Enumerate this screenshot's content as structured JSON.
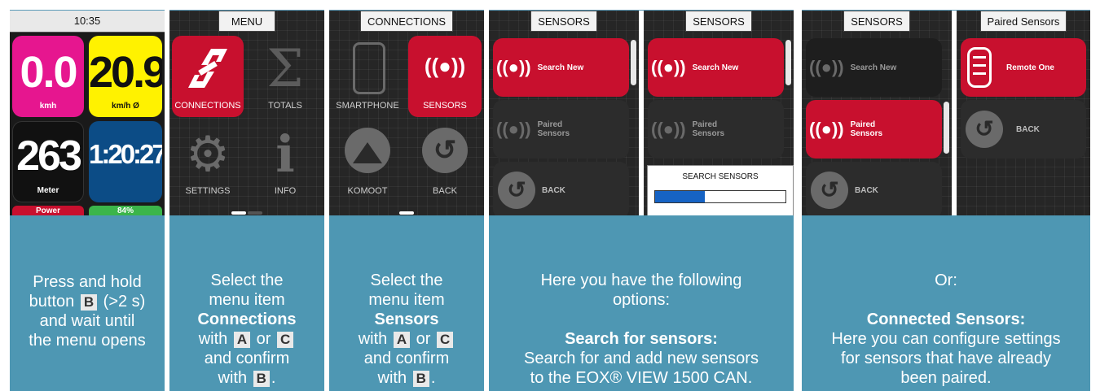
{
  "screens": {
    "s1": {
      "title": "10:35",
      "speed_value": "0.0",
      "speed_unit": "kmh",
      "avg_value": "20.9",
      "avg_unit": "km/h Ø",
      "meter_value": "263",
      "meter_label": "Meter",
      "time_value": "1:20:27",
      "power_label": "Power",
      "battery_label": "84%"
    },
    "s2": {
      "title": "MENU",
      "items": [
        "CONNECTIONS",
        "TOTALS",
        "SETTINGS",
        "INFO"
      ]
    },
    "s3": {
      "title": "CONNECTIONS",
      "items": [
        "SMARTPHONE",
        "SENSORS",
        "KOMOOT",
        "BACK"
      ]
    },
    "s4": {
      "title": "SENSORS",
      "search_new": "Search New",
      "paired": "Paired Sensors",
      "back": "BACK"
    },
    "s5": {
      "title": "SENSORS",
      "search_new": "Search New",
      "paired": "Paired Sensors",
      "dialog_title": "SEARCH SENSORS",
      "progress": 0.38
    },
    "s6": {
      "title": "SENSORS",
      "search_new": "Search New",
      "paired": "Paired Sensors",
      "back": "BACK"
    },
    "s7": {
      "title": "Paired Sensors",
      "remote": "Remote One",
      "back": "BACK"
    }
  },
  "colors": {
    "magenta": "#e6168f",
    "yellow": "#fff200",
    "navy": "#0c4c86",
    "red": "#c8102e",
    "panel": "#4e97b3"
  },
  "panels": {
    "p1": {
      "l1": "Press and hold",
      "l2a": "button",
      "key": "B",
      "l2b": "(>2 s)",
      "l3": "and wait until",
      "l4": "the menu opens"
    },
    "p2": {
      "l1": "Select the",
      "l2": "menu item",
      "l3": "Connections",
      "l4a": "with",
      "k1": "A",
      "or": "or",
      "k2": "C",
      "l5": "and confirm",
      "l6a": "with",
      "k3": "B",
      "dot": "."
    },
    "p3": {
      "l1": "Select the",
      "l2": "menu item",
      "l3": "Sensors",
      "l4a": "with",
      "k1": "A",
      "or": "or",
      "k2": "C",
      "l5": "and confirm",
      "l6a": "with",
      "k3": "B",
      "dot": "."
    },
    "p4": {
      "l1": "Here you have the following",
      "l2": "options:",
      "l3": "Search for sensors:",
      "l4": "Search for and add new sensors",
      "l5": "to the EOX® VIEW 1500 CAN."
    },
    "p5": {
      "l1": "Or:",
      "l2": "Connected Sensors:",
      "l3": "Here you can configure settings",
      "l4": "for sensors that have already",
      "l5": "been paired."
    }
  }
}
